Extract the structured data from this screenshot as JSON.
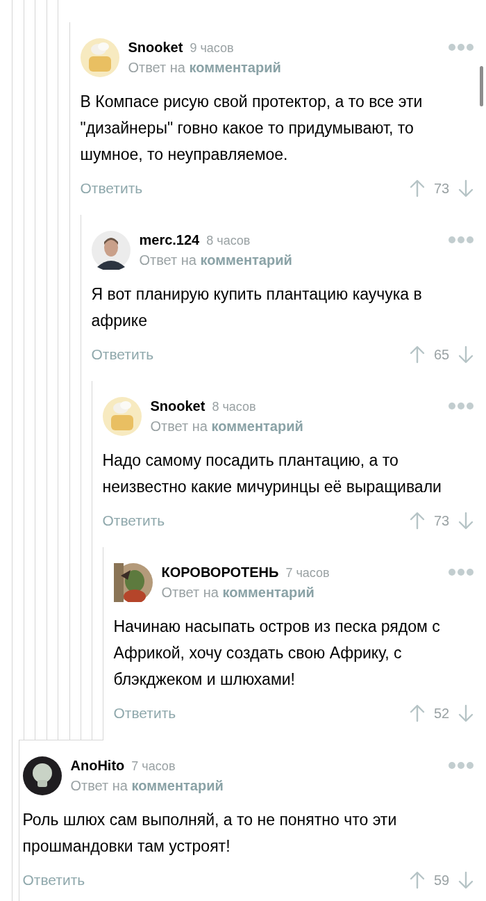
{
  "thread": [
    {
      "author": "Snooket",
      "time": "9 часов",
      "reply_prefix": "Ответ на",
      "reply_link": "комментарий",
      "text": "В Компасе рисую свой протектор, а то все эти \"дизайнеры\" говно какое то придумывают, то шумное, то неуправляемое.",
      "reply_button": "Ответить",
      "score": "73",
      "children": [
        {
          "author": "merc.124",
          "time": "8 часов",
          "reply_prefix": "Ответ на",
          "reply_link": "комментарий",
          "text": "Я вот планирую купить плантацию каучука в африке",
          "reply_button": "Ответить",
          "score": "65",
          "children": [
            {
              "author": "Snooket",
              "time": "8 часов",
              "reply_prefix": "Ответ на",
              "reply_link": "комментарий",
              "text": "Надо самому посадить плантацию, а то неизвестно какие мичуринцы её выращивали",
              "reply_button": "Ответить",
              "score": "73",
              "children": [
                {
                  "author": "КОРОВОРОТЕНЬ",
                  "time": "7 часов",
                  "reply_prefix": "Ответ на",
                  "reply_link": "комментарий",
                  "text": "Начинаю насыпать остров из песка рядом с Африкой, хочу создать свою Африку, с блэкджеком и шлюхами!",
                  "reply_button": "Ответить",
                  "score": "52"
                }
              ]
            }
          ]
        }
      ]
    }
  ],
  "outer_comments": [
    {
      "author": "AnoHito",
      "time": "7 часов",
      "reply_prefix": "Ответ на",
      "reply_link": "комментарий",
      "text": "Роль шлюх сам выполняй, а то не понятно что эти прошмандовки там устроят!",
      "reply_button": "Ответить",
      "score": "59"
    }
  ]
}
